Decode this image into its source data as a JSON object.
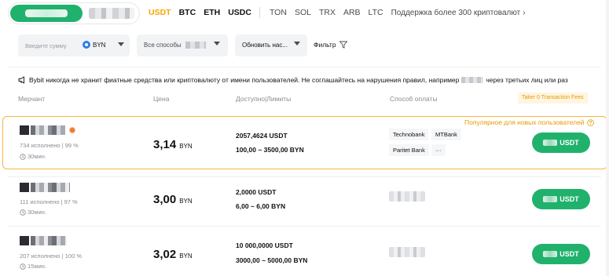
{
  "coins": {
    "items": [
      "USDT",
      "BTC",
      "ETH",
      "USDC"
    ],
    "more": [
      "TON",
      "SOL",
      "TRX",
      "ARB",
      "LTC"
    ],
    "support": "Поддержка более 300 криптовалют"
  },
  "filters": {
    "amount_placeholder": "Введите сумму",
    "currency": "BYN",
    "method": "Все способы",
    "refresh": "Обновить нас...",
    "filter": "Фильтр"
  },
  "notice": {
    "part1": "Bybit никогда не хранит фиатные средства или криптовалюту от имени пользователей. Не соглашайтесь на нарушения правил, например",
    "part2": "через третьих лиц или раз"
  },
  "headers": {
    "merchant": "Мерчант",
    "price": "Цена",
    "available": "Доступно|Лимиты",
    "payment": "Способ оплаты",
    "fees": "Taker 0 Transaction Fees"
  },
  "promo": "Популярное для новых пользователей",
  "ads": [
    {
      "stats": "734 исполнено  |  99 %",
      "time": "30мин.",
      "price": "3,14",
      "unit": "BYN",
      "available": "2057,4624 USDT",
      "limits": "100,00 ~ 3500,00 BYN",
      "payments": [
        "Technobank",
        "MTBank",
        "Paritet Bank",
        "···"
      ],
      "button": "USDT"
    },
    {
      "stats": "111 исполнено  |  97 %",
      "time": "30мин.",
      "price": "3,00",
      "unit": "BYN",
      "available": "2,0000 USDT",
      "limits": "6,00 ~ 6,00 BYN",
      "button": "USDT"
    },
    {
      "stats": "207 исполнено  |  100 %",
      "time": "15мин.",
      "price": "3,02",
      "unit": "BYN",
      "available": "10 000,0000 USDT",
      "limits": "3000,00 ~ 5000,00 BYN",
      "button": "USDT"
    }
  ]
}
